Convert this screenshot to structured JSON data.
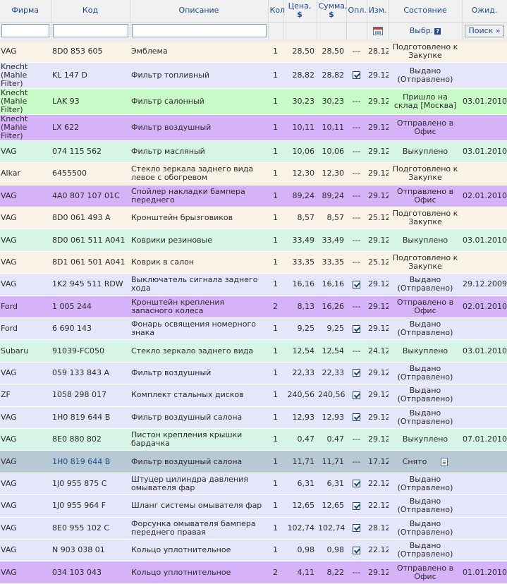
{
  "headers": {
    "firm": "Фирма",
    "code": "Код",
    "description": "Описание",
    "qty": "Кол",
    "price": "Цена,",
    "price_unit": "$",
    "sum": "Сумма,",
    "sum_unit": "$",
    "paid": "Опл.",
    "changed": "Изм.",
    "state": "Состояние",
    "expected": "Ожид."
  },
  "filters": {
    "select_label": "Выбр.",
    "help_symbol": "?",
    "search_button": "Поиск »"
  },
  "rows": [
    {
      "firm": "VAG",
      "code": "8D0 853 605",
      "desc": "Эмблема",
      "qty": "1",
      "price": "28,50",
      "sum": "28,50",
      "paid": "---",
      "checked": false,
      "changed": "28.12",
      "state": "Подготовлено к Закупке",
      "expected": "",
      "style": "a"
    },
    {
      "firm": "Knecht (Mahle Filter)",
      "code": "KL 147 D",
      "desc": "Фильтр топливный",
      "qty": "1",
      "price": "28,82",
      "sum": "28,82",
      "paid": "",
      "checked": true,
      "changed": "29.12",
      "state": "Выдано (Отправлено)",
      "expected": "",
      "style": "b"
    },
    {
      "firm": "Knecht (Mahle Filter)",
      "code": "LAK 93",
      "desc": "Фильтр салонный",
      "qty": "1",
      "price": "30,23",
      "sum": "30,23",
      "paid": "---",
      "checked": false,
      "changed": "29.12",
      "state": "Пришло на склад [Москва]",
      "expected": "03.01.2010",
      "style": "c"
    },
    {
      "firm": "Knecht (Mahle Filter)",
      "code": "LX 622",
      "desc": "Фильтр воздушный",
      "qty": "1",
      "price": "10,11",
      "sum": "10,11",
      "paid": "---",
      "checked": false,
      "changed": "29.12",
      "state": "Отправлено в Офис",
      "expected": "",
      "style": "d"
    },
    {
      "firm": "VAG",
      "code": "074 115 562",
      "desc": "Фильтр масляный",
      "qty": "1",
      "price": "10,06",
      "sum": "10,06",
      "paid": "---",
      "checked": false,
      "changed": "29.12",
      "state": "Выкуплено",
      "expected": "03.01.2010",
      "style": "e"
    },
    {
      "firm": "Alkar",
      "code": "6455500",
      "desc": "Стекло зеркала заднего вида левое с обогревом",
      "qty": "1",
      "price": "12,30",
      "sum": "12,30",
      "paid": "---",
      "checked": false,
      "changed": "29.12",
      "state": "Подготовлено к Закупке",
      "expected": "",
      "style": "a"
    },
    {
      "firm": "VAG",
      "code": "4A0 807 107 01C",
      "desc": "Спойлер накладки бампера переднего",
      "qty": "1",
      "price": "89,24",
      "sum": "89,24",
      "paid": "---",
      "checked": false,
      "changed": "29.12",
      "state": "Отправлено в Офис",
      "expected": "02.01.2010",
      "style": "d"
    },
    {
      "firm": "VAG",
      "code": "8D0 061 493 A",
      "desc": "Кронштейн брызговиков",
      "qty": "1",
      "price": "8,57",
      "sum": "8,57",
      "paid": "---",
      "checked": false,
      "changed": "25.12",
      "state": "Подготовлено к Закупке",
      "expected": "",
      "style": "a"
    },
    {
      "firm": "VAG",
      "code": "8D0 061 511 A041",
      "desc": "Коврики резиновые",
      "qty": "1",
      "price": "33,49",
      "sum": "33,49",
      "paid": "---",
      "checked": false,
      "changed": "29.12",
      "state": "Выкуплено",
      "expected": "03.01.2010",
      "style": "e"
    },
    {
      "firm": "VAG",
      "code": "8D1 061 501 A041",
      "desc": "Коврик в салон",
      "qty": "1",
      "price": "33,35",
      "sum": "33,35",
      "paid": "---",
      "checked": false,
      "changed": "25.12",
      "state": "Подготовлено к Закупке",
      "expected": "",
      "style": "a"
    },
    {
      "firm": "VAG",
      "code": "1K2 945 511 RDW",
      "desc": "Выключатель сигнала заднего хода",
      "qty": "1",
      "price": "16,16",
      "sum": "16,16",
      "paid": "",
      "checked": true,
      "changed": "29.12",
      "state": "Выдано (Отправлено)",
      "expected": "29.12.2009",
      "style": "b"
    },
    {
      "firm": "Ford",
      "code": "1 005 244",
      "desc": "Кронштейн крепления запасного колеса",
      "qty": "2",
      "price": "8,13",
      "sum": "16,26",
      "paid": "---",
      "checked": false,
      "changed": "29.12",
      "state": "Отправлено в Офис",
      "expected": "02.01.2010",
      "style": "d"
    },
    {
      "firm": "Ford",
      "code": "6 690 143",
      "desc": "Фонарь освящения номерного знака",
      "qty": "1",
      "price": "9,25",
      "sum": "9,25",
      "paid": "",
      "checked": true,
      "changed": "29.12",
      "state": "Выдано (Отправлено)",
      "expected": "",
      "style": "b"
    },
    {
      "firm": "Subaru",
      "code": "91039-FC050",
      "desc": "Стекло зеркало заднего вида",
      "qty": "1",
      "price": "12,54",
      "sum": "12,54",
      "paid": "---",
      "checked": false,
      "changed": "24.12",
      "state": "Выкуплено",
      "expected": "03.01.2010",
      "style": "e"
    },
    {
      "firm": "VAG",
      "code": "059 133 843 A",
      "desc": "Фильтр воздушный",
      "qty": "1",
      "price": "22,33",
      "sum": "22,33",
      "paid": "",
      "checked": true,
      "changed": "29.12",
      "state": "Выдано (Отправлено)",
      "expected": "",
      "style": "b"
    },
    {
      "firm": "ZF",
      "code": "1058 298 017",
      "desc": "Комплект стальных дисков",
      "qty": "1",
      "price": "240,56",
      "sum": "240,56",
      "paid": "",
      "checked": true,
      "changed": "29.12",
      "state": "Выдано (Отправлено)",
      "expected": "",
      "style": "b"
    },
    {
      "firm": "VAG",
      "code": "1H0 819 644 B",
      "desc": "Фильтр воздушный салона",
      "qty": "1",
      "price": "12,93",
      "sum": "12,93",
      "paid": "",
      "checked": true,
      "changed": "29.12",
      "state": "Выдано (Отправлено)",
      "expected": "",
      "style": "b"
    },
    {
      "firm": "VAG",
      "code": "8E0 880 802",
      "desc": "Пистон крепления крышки бардачка",
      "qty": "1",
      "price": "0,47",
      "sum": "0,47",
      "paid": "---",
      "checked": false,
      "changed": "29.12",
      "state": "Выкуплено",
      "expected": "07.01.2010",
      "style": "e"
    },
    {
      "firm": "VAG",
      "code": "1H0 819 644 B",
      "desc": "Фильтр воздушный салона",
      "qty": "1",
      "price": "11,71",
      "sum": "11,71",
      "paid": "---",
      "checked": false,
      "changed": "17.12",
      "state": "Снято",
      "expected": "",
      "style": "f",
      "edit_icon": "edit-icon"
    },
    {
      "firm": "VAG",
      "code": "1J0 955 875 C",
      "desc": "Штуцер цилиндра давления омывателя фар",
      "qty": "1",
      "price": "6,31",
      "sum": "6,31",
      "paid": "",
      "checked": true,
      "changed": "22.12",
      "state": "Выдано (Отправлено)",
      "expected": "",
      "style": "b"
    },
    {
      "firm": "VAG",
      "code": "1J0 955 964 F",
      "desc": "Шланг системы омывателя фар",
      "qty": "1",
      "price": "12,65",
      "sum": "12,65",
      "paid": "",
      "checked": true,
      "changed": "22.12",
      "state": "Выдано (Отправлено)",
      "expected": "",
      "style": "b"
    },
    {
      "firm": "VAG",
      "code": "8E0 955 102 C",
      "desc": "Форсунка омывателя бампера переднего правая",
      "qty": "1",
      "price": "102,74",
      "sum": "102,74",
      "paid": "",
      "checked": true,
      "changed": "28.12",
      "state": "Выдано (Отправлено)",
      "expected": "",
      "style": "b"
    },
    {
      "firm": "VAG",
      "code": "N 903 038 01",
      "desc": "Кольцо уплотнительное",
      "qty": "1",
      "price": "0,98",
      "sum": "0,98",
      "paid": "",
      "checked": true,
      "changed": "22.12",
      "state": "Выдано (Отправлено)",
      "expected": "",
      "style": "b"
    },
    {
      "firm": "VAG",
      "code": "034 103 043",
      "desc": "Кольцо уплотнительное",
      "qty": "2",
      "price": "4,11",
      "sum": "8,22",
      "paid": "---",
      "checked": false,
      "changed": "29.12",
      "state": "Отправлено в Офис",
      "expected": "01.01.2010",
      "style": "d"
    }
  ]
}
